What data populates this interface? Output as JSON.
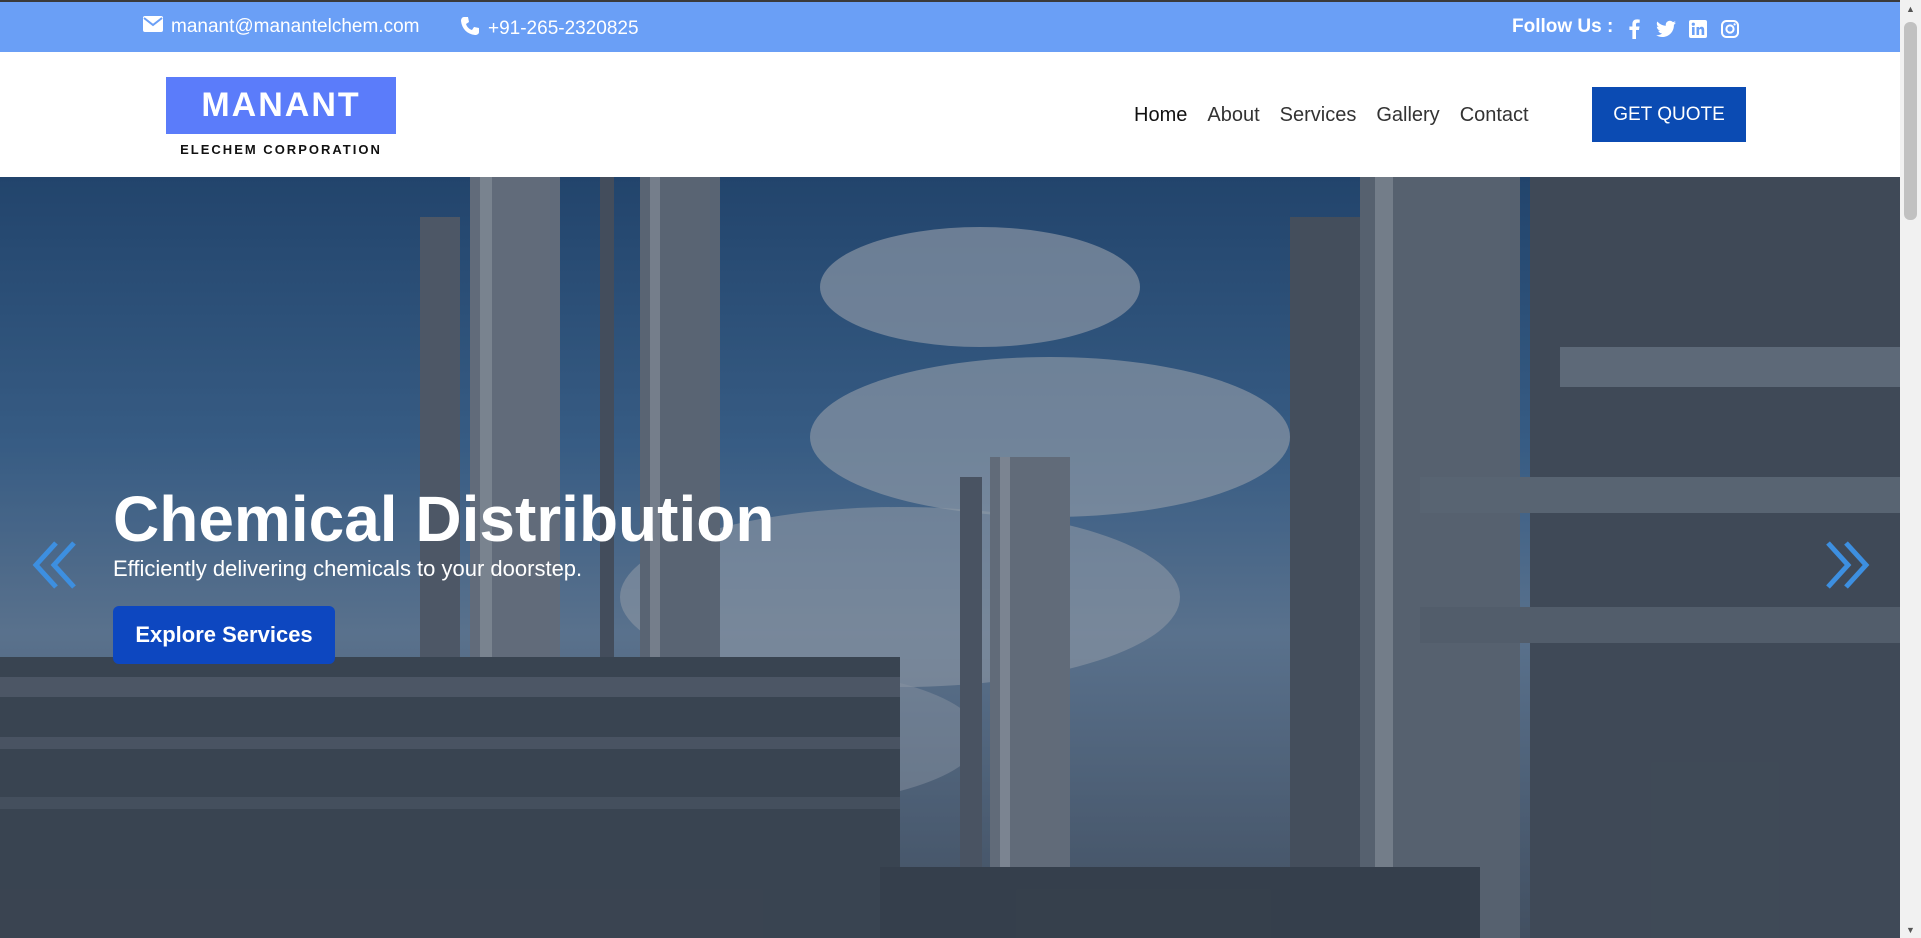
{
  "topbar": {
    "email": "manant@manantelchem.com",
    "phone": "+91-265-2320825",
    "follow_label": "Follow Us :",
    "socials": [
      "facebook-icon",
      "twitter-icon",
      "linkedin-icon",
      "instagram-icon"
    ]
  },
  "header": {
    "logo_title": "MANANT",
    "logo_subtitle": "ELECHEM CORPORATION",
    "nav": [
      "Home",
      "About",
      "Services",
      "Gallery",
      "Contact"
    ],
    "quote_button": "GET QUOTE"
  },
  "hero": {
    "title": "Chemical Distribution",
    "subtitle": "Efficiently delivering chemicals to your doorstep.",
    "button": "Explore Services"
  },
  "colors": {
    "topbar": "#6a9ff6",
    "logo_bg": "#5b7cfa",
    "primary_button": "#0b4bb3",
    "arrow": "#3d8fe0"
  }
}
